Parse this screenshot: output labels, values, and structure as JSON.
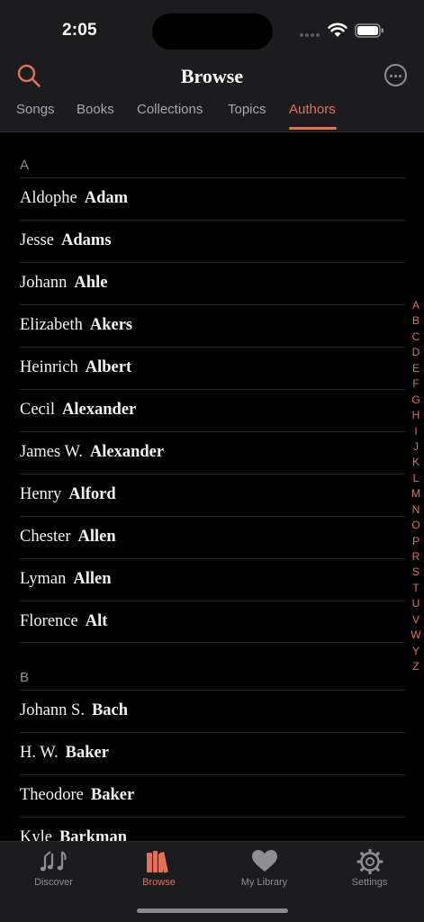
{
  "status": {
    "time": "2:05"
  },
  "header": {
    "title": "Browse"
  },
  "tabs": [
    {
      "label": "Songs"
    },
    {
      "label": "Books"
    },
    {
      "label": "Collections"
    },
    {
      "label": "Topics"
    },
    {
      "label": "Authors",
      "active": true
    }
  ],
  "sections": [
    {
      "letter": "A",
      "authors": [
        {
          "first": "Aldophe",
          "last": "Adam"
        },
        {
          "first": "Jesse",
          "last": "Adams"
        },
        {
          "first": "Johann",
          "last": "Ahle"
        },
        {
          "first": "Elizabeth",
          "last": "Akers"
        },
        {
          "first": "Heinrich",
          "last": "Albert"
        },
        {
          "first": "Cecil",
          "last": "Alexander"
        },
        {
          "first": "James W.",
          "last": "Alexander"
        },
        {
          "first": "Henry",
          "last": "Alford"
        },
        {
          "first": "Chester",
          "last": "Allen"
        },
        {
          "first": "Lyman",
          "last": "Allen"
        },
        {
          "first": "Florence",
          "last": "Alt"
        }
      ]
    },
    {
      "letter": "B",
      "authors": [
        {
          "first": "Johann S.",
          "last": "Bach"
        },
        {
          "first": "H. W.",
          "last": "Baker"
        },
        {
          "first": "Theodore",
          "last": "Baker"
        },
        {
          "first": "Kyle",
          "last": "Barkman"
        }
      ]
    }
  ],
  "index_letters": [
    "A",
    "B",
    "C",
    "D",
    "E",
    "F",
    "G",
    "H",
    "I",
    "J",
    "K",
    "L",
    "M",
    "N",
    "O",
    "P",
    "R",
    "S",
    "T",
    "U",
    "V",
    "W",
    "Y",
    "Z"
  ],
  "tabbar": [
    {
      "label": "Discover",
      "icon": "music-notes-icon"
    },
    {
      "label": "Browse",
      "icon": "books-icon",
      "active": true
    },
    {
      "label": "My Library",
      "icon": "heart-icon"
    },
    {
      "label": "Settings",
      "icon": "gear-icon"
    }
  ],
  "colors": {
    "accent": "#e0725a",
    "background": "#000000",
    "bar": "#1c1c1e",
    "muted": "#8e8e93"
  }
}
